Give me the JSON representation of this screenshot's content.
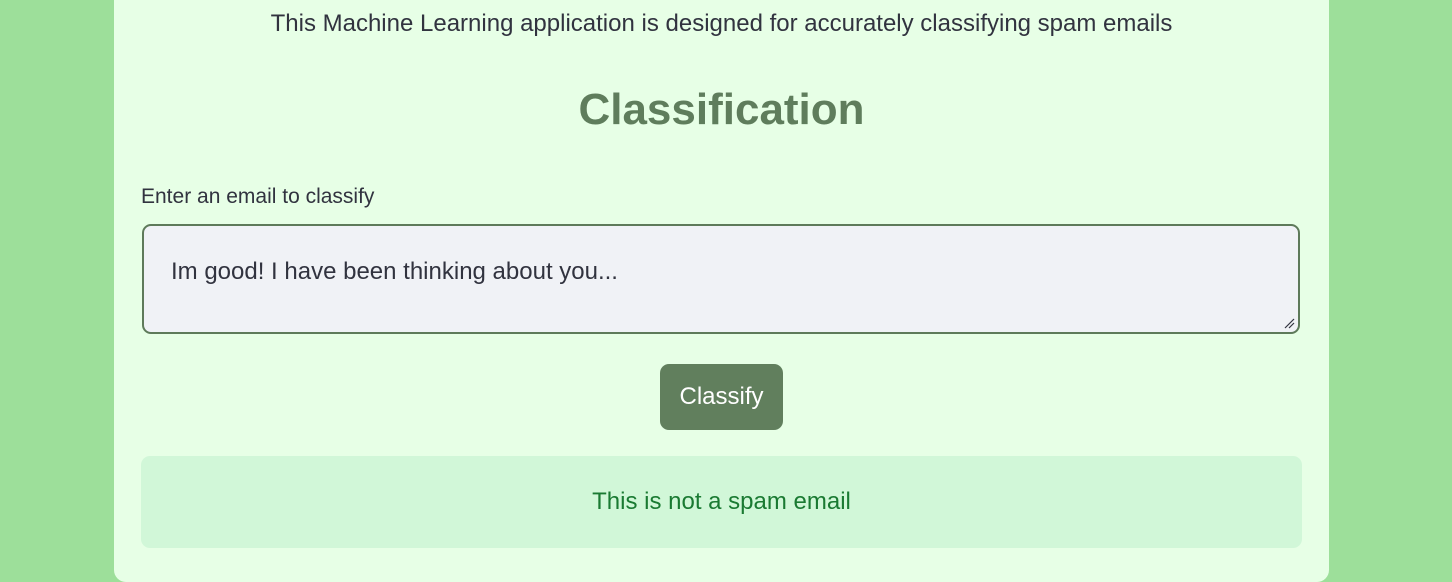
{
  "app": {
    "description": "This Machine Learning application is designed for accurately classifying spam emails",
    "section_title": "Classification"
  },
  "form": {
    "label": "Enter an email to classify",
    "email_value": "Im good! I have been thinking about you...",
    "submit_label": "Classify"
  },
  "result": {
    "message": "This is not a spam email"
  },
  "colors": {
    "page_background": "#9ddf9a",
    "card_background": "#e7ffe6",
    "accent": "#617f5d",
    "result_background": "#d1f7d8",
    "result_text": "#1a7a32"
  }
}
